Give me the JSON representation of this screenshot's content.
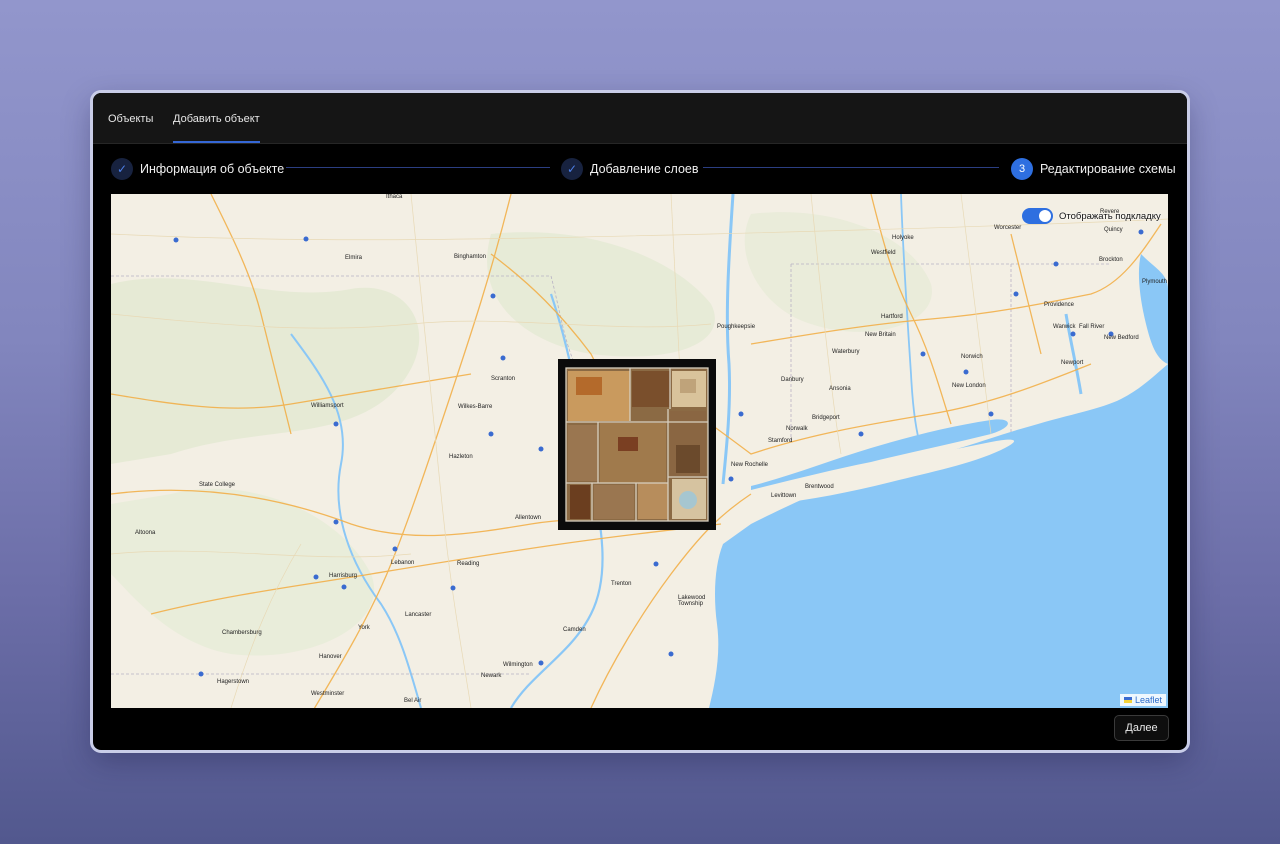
{
  "tabs": [
    {
      "label": "Объекты",
      "active": false
    },
    {
      "label": "Добавить объект",
      "active": true
    }
  ],
  "stepper": {
    "steps": [
      {
        "label": "Информация об объекте",
        "status": "done",
        "icon": "check-icon"
      },
      {
        "label": "Добавление слоев",
        "status": "done",
        "icon": "check-icon"
      },
      {
        "number": "3",
        "label": "Редактирование схемы",
        "status": "current"
      }
    ]
  },
  "map": {
    "toggle_label": "Отображать подкладку",
    "toggle_on": true,
    "attribution": "Leaflet",
    "cities": [
      "Ithaca",
      "Elmira",
      "Binghamton",
      "Scranton",
      "Wilkes-Barre",
      "Williamsport",
      "State College",
      "Hazleton",
      "Allentown",
      "Harrisburg",
      "Lancaster",
      "York",
      "Reading",
      "Lebanon",
      "Trenton",
      "Camden",
      "Wilmington",
      "Newark",
      "Hanover",
      "Hagerstown",
      "Chambersburg",
      "Altoona",
      "Westminster",
      "Bel Air",
      "Lakewood Township",
      "New Rochelle",
      "Stamford",
      "Norwalk",
      "Bridgeport",
      "Danbury",
      "Waterbury",
      "Hartford",
      "New Britain",
      "Westfield",
      "Holyoke",
      "Worcester",
      "Providence",
      "Warwick",
      "Fall River",
      "New Bedford",
      "Newport",
      "Norwich",
      "New London",
      "Levittown",
      "Brentwood",
      "Brockton",
      "Plymouth",
      "Quincy",
      "Revere",
      "Poughkeepsie",
      "Ansonia"
    ]
  },
  "footer": {
    "next_label": "Далее"
  },
  "colors": {
    "accent": "#2e6fe0",
    "water": "#8ac7f6",
    "land": "#f3efe4",
    "window_bg": "#000000",
    "tabbar_bg": "#151515"
  }
}
